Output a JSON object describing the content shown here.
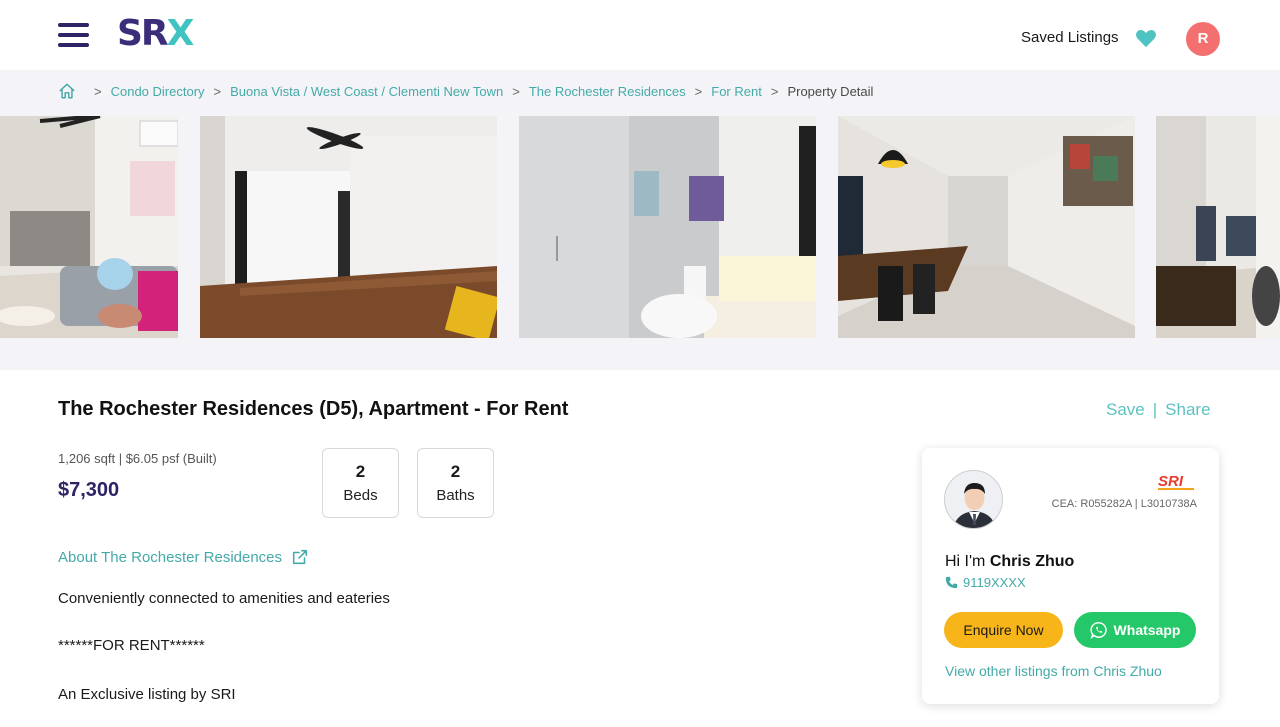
{
  "header": {
    "saved_listings": "Saved Listings",
    "avatar_initial": "R"
  },
  "breadcrumb": {
    "items": [
      "Condo Directory",
      "Buona Vista / West Coast / Clementi New Town",
      "The Rochester Residences",
      "For Rent"
    ],
    "current": "Property Detail"
  },
  "gallery": {
    "photos": [
      "living-room",
      "bedroom",
      "bathroom",
      "dining-room",
      "living-room-2"
    ]
  },
  "listing": {
    "title": "The Rochester Residences (D5), Apartment - For Rent",
    "size_info": "1,206 sqft | $6.05 psf (Built)",
    "price": "$7,300",
    "beds": {
      "value": "2",
      "label": "Beds"
    },
    "baths": {
      "value": "2",
      "label": "Baths"
    },
    "about_link": "About The Rochester Residences",
    "description": [
      "Conveniently connected to amenities and eateries",
      "******FOR RENT******",
      "An Exclusive listing by SRI"
    ]
  },
  "actions": {
    "save": "Save",
    "divider": "|",
    "share": "Share"
  },
  "agent": {
    "cea": "CEA: R055282A | L3010738A",
    "greeting": "Hi I'm",
    "name": "Chris Zhuo",
    "phone": "9119XXXX",
    "enquire": "Enquire Now",
    "whatsapp": "Whatsapp",
    "view_other": "View other listings from Chris Zhuo"
  },
  "colors": {
    "brand_purple": "#2d2466",
    "brand_teal": "#44aaa8",
    "enquire_yellow": "#f7b519",
    "whatsapp_green": "#25c868",
    "avatar_red": "#f47070"
  }
}
